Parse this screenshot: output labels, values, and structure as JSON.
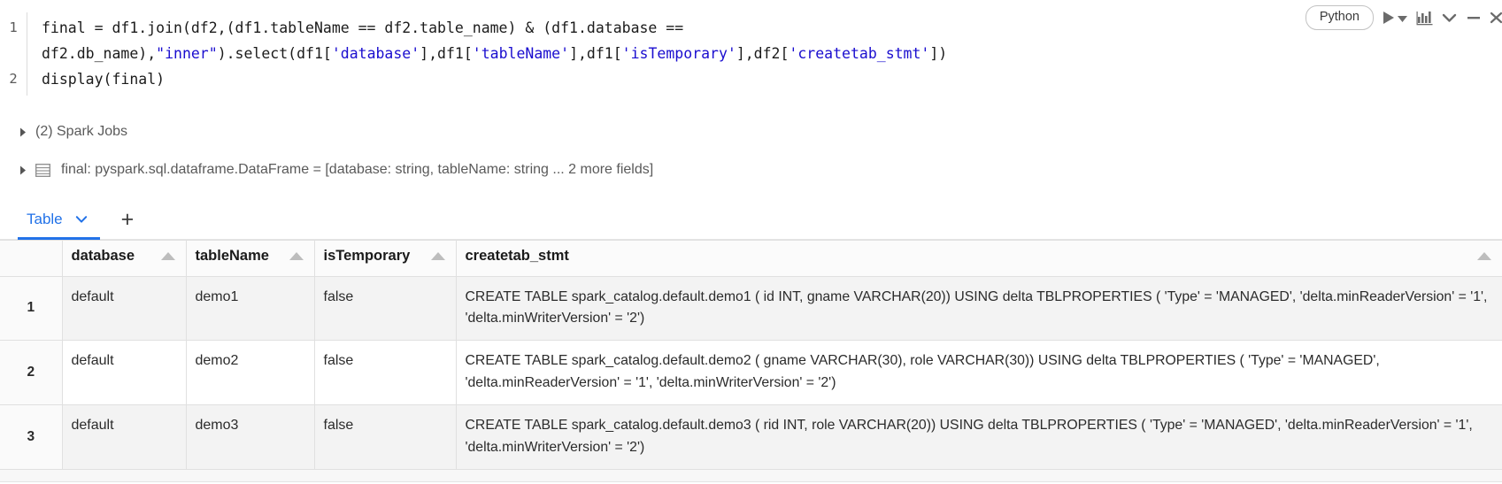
{
  "cell": {
    "language_label": "Python",
    "line_numbers": [
      "1",
      "2"
    ],
    "code_segments": [
      {
        "t": "plain",
        "v": "final = df1.join(df2,(df1.tableName == df2.table_name) & (df1.database == df2.db_name),"
      },
      {
        "t": "str",
        "v": "\"inner\""
      },
      {
        "t": "plain",
        "v": ").select(df1["
      },
      {
        "t": "str",
        "v": "'database'"
      },
      {
        "t": "plain",
        "v": "],df1["
      },
      {
        "t": "str",
        "v": "'tableName'"
      },
      {
        "t": "plain",
        "v": "],df1["
      },
      {
        "t": "str",
        "v": "'isTemporary'"
      },
      {
        "t": "plain",
        "v": "],df2["
      },
      {
        "t": "str",
        "v": "'createtab_stmt'"
      },
      {
        "t": "plain",
        "v": "])\ndisplay(final)"
      }
    ]
  },
  "toolbar": {
    "run_icon": "play-icon",
    "run_dropdown_icon": "caret-down-icon",
    "chart_icon": "bar-chart-icon",
    "collapse_icon": "chevron-down-icon",
    "minimize_icon": "minimize-icon",
    "close_icon": "close-icon"
  },
  "output": {
    "spark_jobs_label": "(2) Spark Jobs",
    "dataframe_label": "final:  pyspark.sql.dataframe.DataFrame = [database: string, tableName: string ... 2 more fields]"
  },
  "tabs": {
    "table_tab_label": "Table",
    "add_tab_label": "+"
  },
  "table": {
    "columns": [
      {
        "label": "",
        "sortable": false
      },
      {
        "label": "database",
        "sortable": true
      },
      {
        "label": "tableName",
        "sortable": true
      },
      {
        "label": "isTemporary",
        "sortable": true
      },
      {
        "label": "createtab_stmt",
        "sortable": true
      }
    ],
    "rows": [
      {
        "num": "1",
        "database": "default",
        "tableName": "demo1",
        "isTemporary": "false",
        "createtab_stmt": "CREATE TABLE spark_catalog.default.demo1 (   id INT,   gname VARCHAR(20)) USING delta TBLPROPERTIES (   'Type' = 'MANAGED',   'delta.minReaderVersion' = '1',   'delta.minWriterVersion' = '2')"
      },
      {
        "num": "2",
        "database": "default",
        "tableName": "demo2",
        "isTemporary": "false",
        "createtab_stmt": "CREATE TABLE spark_catalog.default.demo2 (   gname VARCHAR(30),   role VARCHAR(30)) USING delta TBLPROPERTIES (   'Type' = 'MANAGED',   'delta.minReaderVersion' = '1',   'delta.minWriterVersion' = '2')"
      },
      {
        "num": "3",
        "database": "default",
        "tableName": "demo3",
        "isTemporary": "false",
        "createtab_stmt": "CREATE TABLE spark_catalog.default.demo3 (   rid INT,   role VARCHAR(20)) USING delta TBLPROPERTIES (   'Type' = 'MANAGED',   'delta.minReaderVersion' = '1',   'delta.minWriterVersion' = '2')"
      }
    ]
  },
  "colors": {
    "accent": "#2272e8",
    "string_token": "#1a0dcf",
    "row_alt": "#f3f3f3",
    "border": "#e0e0e0"
  }
}
